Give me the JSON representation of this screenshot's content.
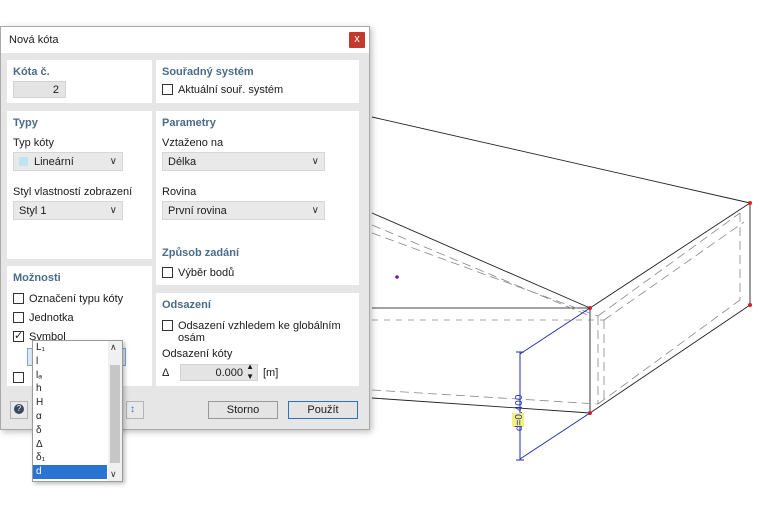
{
  "dialog": {
    "title": "Nová kóta",
    "close": "x"
  },
  "number": {
    "heading": "Kóta č.",
    "value": "2"
  },
  "coord": {
    "heading": "Souřadný systém",
    "current_label": "Aktuální souř. systém",
    "current_checked": false
  },
  "types": {
    "heading": "Typy",
    "type_label": "Typ kóty",
    "type_value": "Lineární",
    "style_label": "Styl vlastností zobrazení",
    "style_value": "Styl 1"
  },
  "params": {
    "heading": "Parametry",
    "related_label": "Vztaženo na",
    "related_value": "Délka",
    "plane_label": "Rovina",
    "plane_value": "První rovina"
  },
  "options": {
    "heading": "Možnosti",
    "type_mark_label": "Označení typu kóty",
    "unit_label": "Jednotka",
    "symbol_label": "Symbol",
    "symbol_value": "d"
  },
  "input": {
    "heading": "Způsob zadání",
    "pick_label": "Výběr bodů"
  },
  "offset": {
    "heading": "Odsazení",
    "global_label": "Odsazení vzhledem ke globálním osám",
    "dim_offset_label": "Odsazení kóty",
    "delta": "Δ",
    "value": "0.000",
    "unit": "[m]"
  },
  "buttons": {
    "cancel": "Storno",
    "apply": "Použít"
  },
  "symbol_options": [
    "L₁",
    "l",
    "lₐ",
    "h",
    "H",
    "α",
    "δ",
    "Δ",
    "δ₁",
    "d"
  ],
  "symbol_selected_index": 9,
  "drawing": {
    "dimension_label": "d=0.400"
  },
  "colors": {
    "accent": "#2a73d1",
    "heading": "#4a6b8a",
    "close": "#c4392d",
    "highlight": "#f5f07a",
    "dim_line": "#1f2fa8"
  }
}
